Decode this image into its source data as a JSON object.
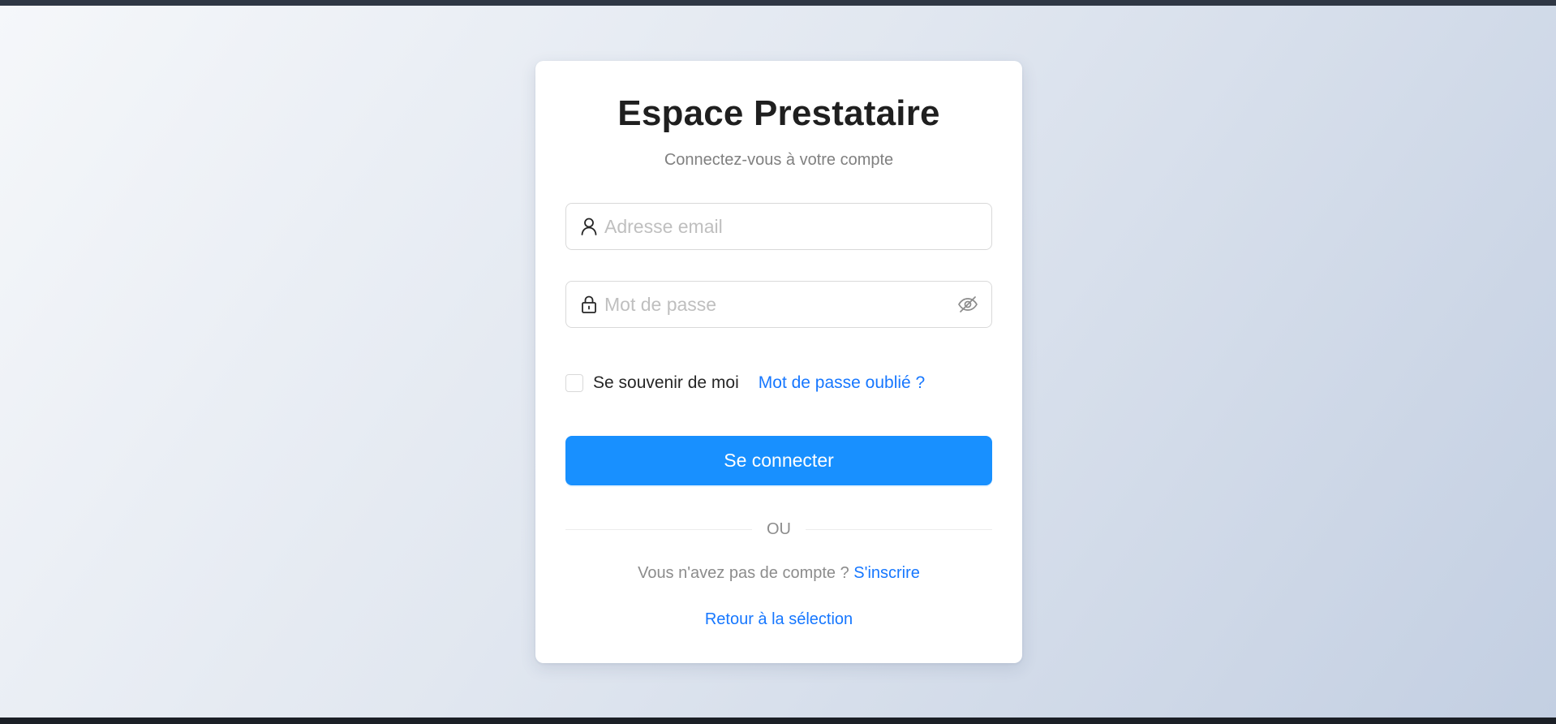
{
  "page": {
    "title": "Espace Prestataire",
    "subtitle": "Connectez-vous à votre compte"
  },
  "form": {
    "email": {
      "placeholder": "Adresse email",
      "value": "",
      "icon": "user-icon"
    },
    "password": {
      "placeholder": "Mot de passe",
      "value": "",
      "icon": "lock-icon",
      "toggle_icon": "eye-invisible-icon"
    },
    "remember_label": "Se souvenir de moi",
    "remember_checked": false,
    "forgot_label": "Mot de passe oublié ?",
    "submit_label": "Se connecter"
  },
  "divider": {
    "label": "OU"
  },
  "signup": {
    "prompt": "Vous n'avez pas de compte ? ",
    "link_label": "S'inscrire"
  },
  "back": {
    "label": "Retour à la sélection"
  },
  "colors": {
    "primary": "#1890ff",
    "link": "#1677ff",
    "card": "#ffffff",
    "bg_start": "#f5f7fa",
    "bg_end": "#c3cfe2"
  }
}
